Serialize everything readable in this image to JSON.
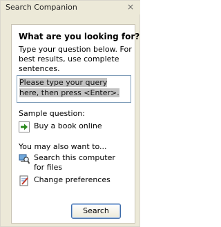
{
  "window": {
    "title": "Search Companion",
    "close_glyph": "×"
  },
  "panel": {
    "heading": "What are you looking for?",
    "instructions": "Type your question below. For best results, use complete sentences.",
    "query_value": "Please type your query here, then press <Enter>.",
    "sample_label": "Sample question:",
    "sample_question": "Buy a book online",
    "also_label": "You may also want to...",
    "links": [
      {
        "label": "Search this computer for files",
        "icon": "computer-search-icon"
      },
      {
        "label": "Change preferences",
        "icon": "preferences-icon"
      }
    ],
    "search_button": "Search"
  },
  "colors": {
    "window_bg": "#ece9d8",
    "panel_bg": "#ffffff",
    "query_highlight": "#c3c3c3",
    "arrow_green": "#2a8a1e"
  }
}
